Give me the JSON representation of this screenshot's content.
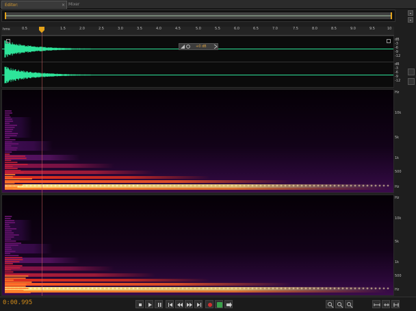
{
  "tabs": [
    {
      "label": "Editor: grenade0_01_(1).wav",
      "active": true
    },
    {
      "label": "Mixer",
      "active": false
    }
  ],
  "ruler": {
    "unit": "hms",
    "ticks": [
      "0.5",
      "1.5",
      "2.0",
      "2.5",
      "3.0",
      "3.5",
      "4.0",
      "4.5",
      "5.0",
      "5.5",
      "6.0",
      "6.5",
      "7.0",
      "7.5",
      "8.0",
      "8.5",
      "9.0",
      "9.5",
      "10"
    ]
  },
  "hud": {
    "gain": "+0 dB"
  },
  "amp_scale": {
    "ch1": [
      "dB",
      "-3",
      "-6",
      "-9",
      "-12"
    ],
    "ch2": [
      "dB",
      "-3",
      "-6",
      "-9",
      "-12"
    ]
  },
  "freq_scale": {
    "ch1": [
      "Hz",
      "10k",
      "5k",
      "1k",
      "500",
      "Hz"
    ],
    "ch2": [
      "Hz",
      "10k",
      "5k",
      "1k",
      "500",
      "Hz"
    ]
  },
  "status": {
    "timecode": "0:00.995"
  },
  "colors": {
    "waveform": "#2ee59a",
    "accent": "#e3a21a",
    "spectral_hot": "#ffd24a",
    "spectral_mid": "#e6311c",
    "spectral_low": "#5a1466"
  },
  "transport": [
    "stop-icon",
    "play-icon",
    "pause-icon",
    "go-start-icon",
    "rewind-icon",
    "fast-forward-icon",
    "go-end-icon",
    "record-icon",
    "loop-icon",
    "skip-icon"
  ],
  "zoom_tools": [
    "zoom-in-amp-icon",
    "zoom-out-amp-icon",
    "zoom-in-time-icon",
    "zoom-out-time-icon",
    "zoom-full-icon",
    "zoom-selection-icon"
  ]
}
